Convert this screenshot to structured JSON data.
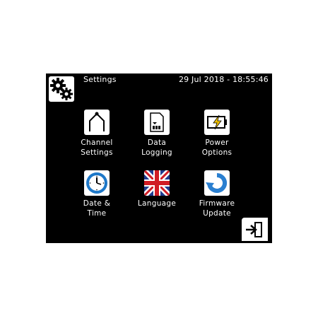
{
  "header": {
    "title": "Settings",
    "datetime": "29 Jul 2018 - 18:55:46",
    "icon": "gears-icon"
  },
  "menu": [
    {
      "icon": "channel-settings-icon",
      "line1": "Channel",
      "line2": "Settings"
    },
    {
      "icon": "data-logging-icon",
      "line1": "Data",
      "line2": "Logging"
    },
    {
      "icon": "power-options-icon",
      "line1": "Power",
      "line2": "Options"
    },
    {
      "icon": "clock-icon",
      "line1": "Date &",
      "line2": "Time"
    },
    {
      "icon": "uk-flag-icon",
      "line1": "Language",
      "line2": ""
    },
    {
      "icon": "firmware-update-icon",
      "line1": "Firmware",
      "line2": "Update"
    }
  ],
  "exit": {
    "icon": "exit-icon"
  },
  "colors": {
    "background": "#000000",
    "text": "#ffffff",
    "battery_bolt": "#f2c200",
    "clock_blue": "#1e78c8",
    "flag_blue": "#1f3b8f",
    "flag_red": "#d01c25",
    "update_blue": "#2a7fd0"
  }
}
